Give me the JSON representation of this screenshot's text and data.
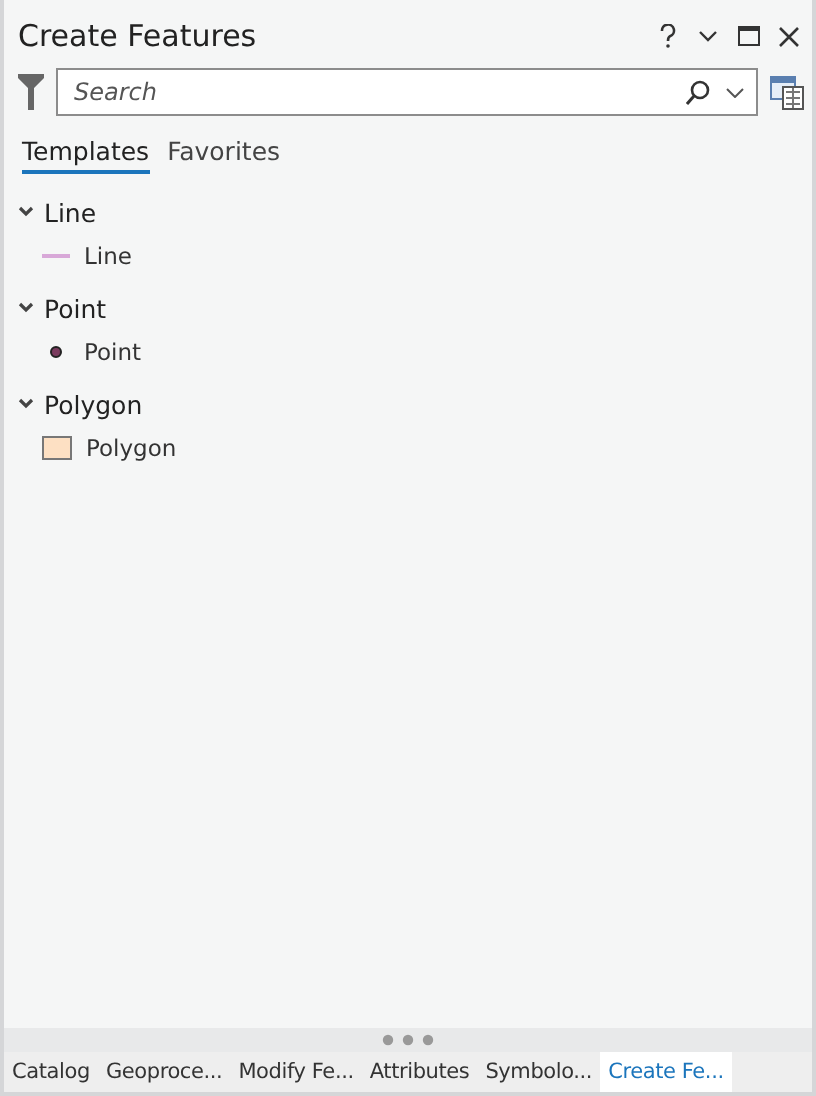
{
  "window": {
    "title": "Create Features"
  },
  "search": {
    "placeholder": "Search"
  },
  "tabs": [
    {
      "label": "Templates",
      "selected": true
    },
    {
      "label": "Favorites",
      "selected": false
    }
  ],
  "groups": [
    {
      "label": "Line",
      "expanded": true,
      "children": [
        {
          "label": "Line",
          "kind": "line",
          "color": "#d8a8d8"
        }
      ]
    },
    {
      "label": "Point",
      "expanded": true,
      "children": [
        {
          "label": "Point",
          "kind": "point",
          "color": "#7a3b5e"
        }
      ]
    },
    {
      "label": "Polygon",
      "expanded": true,
      "children": [
        {
          "label": "Polygon",
          "kind": "polygon",
          "color": "#fde0c3"
        }
      ]
    }
  ],
  "dock_tabs": [
    {
      "label": "Catalog",
      "selected": false
    },
    {
      "label": "Geoproce...",
      "selected": false
    },
    {
      "label": "Modify Fe...",
      "selected": false
    },
    {
      "label": "Attributes",
      "selected": false
    },
    {
      "label": "Symbolo...",
      "selected": false
    },
    {
      "label": "Create Fe...",
      "selected": true
    }
  ]
}
